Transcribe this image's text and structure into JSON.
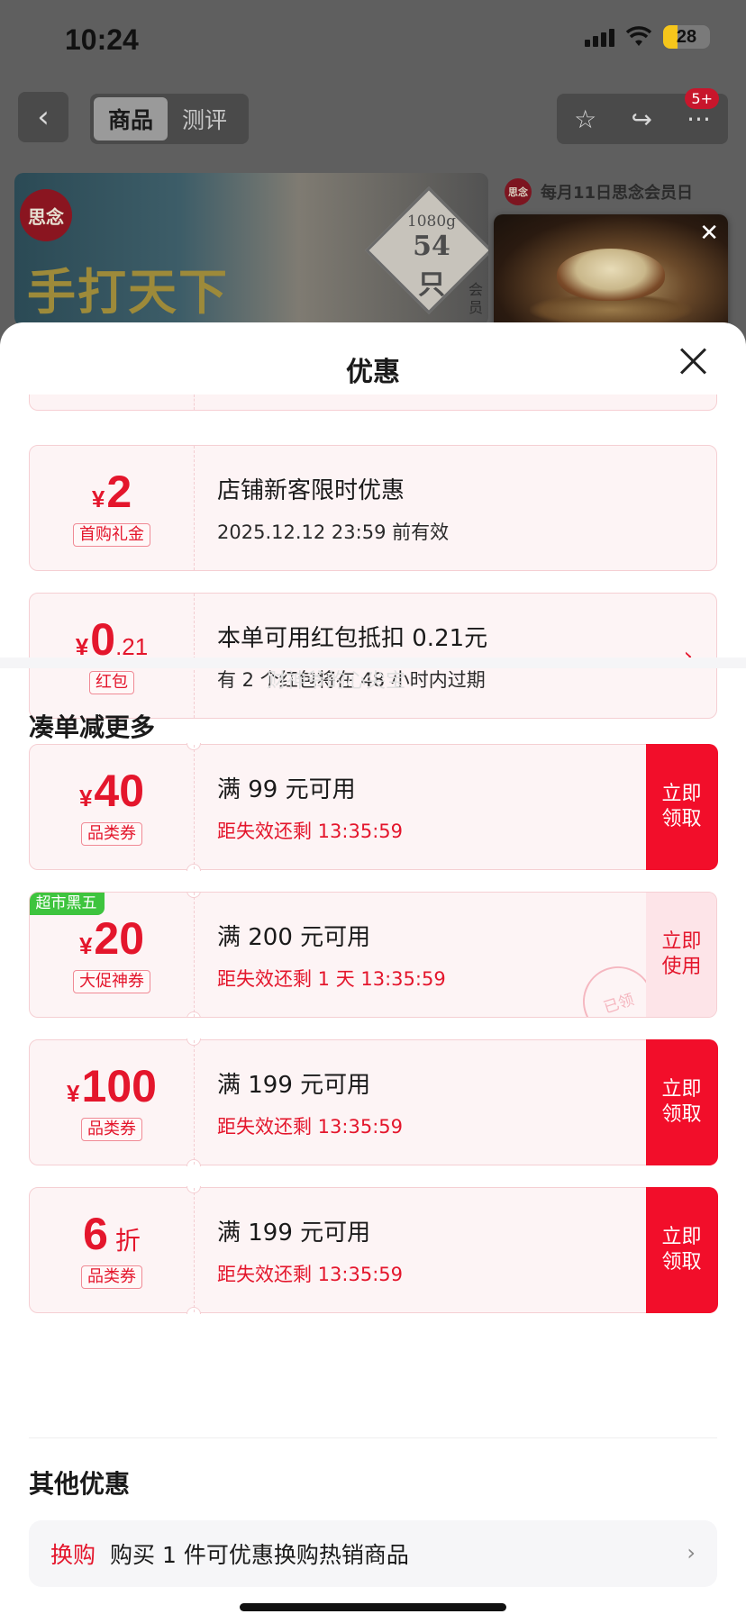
{
  "status": {
    "time": "10:24",
    "battery": "28"
  },
  "nav": {
    "tabs": [
      "商品",
      "测评"
    ],
    "badge": "5+"
  },
  "banner": {
    "title": "手打天下",
    "weight_line1": "1080g",
    "weight_line2": "54只",
    "side_text": "会员",
    "member_text": "每月11日思念会员日"
  },
  "sheet": {
    "title": "优惠",
    "cards": [
      {
        "currency": "¥",
        "amount": "2",
        "tag": "首购礼金",
        "title": "店铺新客限时优惠",
        "subtitle": "2025.12.12 23:59 前有效"
      },
      {
        "currency": "¥",
        "amount": "0",
        "decimal": ".21",
        "tag": "红包",
        "title": "本单可用红包抵扣 0.21元",
        "subtitle": "有 2 个红包将在 48 小时内过期"
      }
    ],
    "section_more": {
      "title": "凑单减更多",
      "watermark": "财神爷的心尖宝",
      "coupons": [
        {
          "currency": "¥",
          "amount": "40",
          "tag": "品类券",
          "title": "满 99 元可用",
          "countdown": "距失效还剩 13:35:59",
          "action": "立即领取",
          "style": "primary"
        },
        {
          "currency": "¥",
          "amount": "20",
          "tag": "大促神券",
          "corner": "超市黑五",
          "title": "满 200 元可用",
          "countdown": "距失效还剩 1 天 13:35:59",
          "action": "立即使用",
          "style": "secondary",
          "stamp": "已领"
        },
        {
          "currency": "¥",
          "amount": "100",
          "tag": "品类券",
          "title": "满 199 元可用",
          "countdown": "距失效还剩 13:35:59",
          "action": "立即领取",
          "style": "primary"
        },
        {
          "amount": "6",
          "unit": "折",
          "tag": "品类券",
          "title": "满 199 元可用",
          "countdown": "距失效还剩 13:35:59",
          "action": "立即领取",
          "style": "primary"
        }
      ]
    },
    "section_other": {
      "title": "其他优惠",
      "tag": "换购",
      "text": "购买 1 件可优惠换购热销商品"
    }
  }
}
